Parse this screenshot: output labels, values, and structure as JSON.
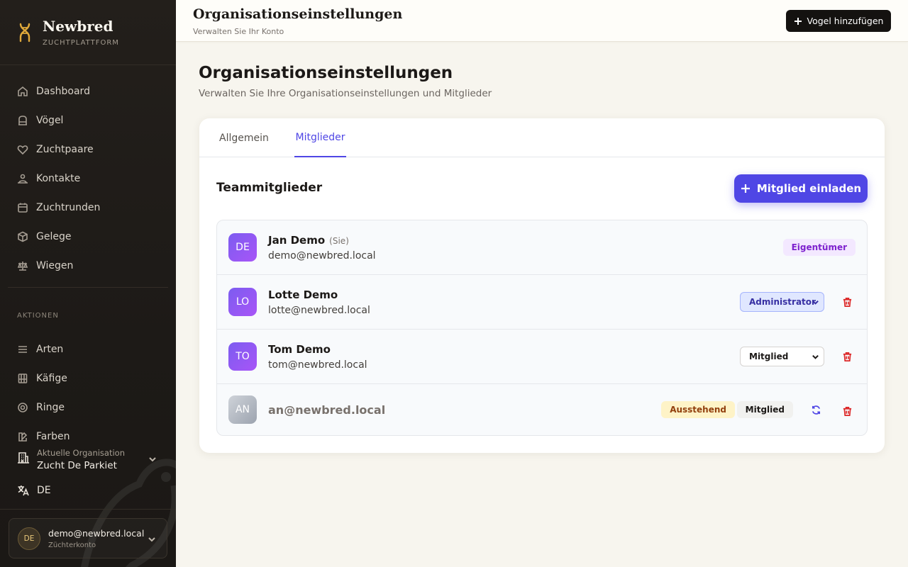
{
  "brand": {
    "name": "Newbred",
    "subtitle": "ZUCHTPLATTFORM"
  },
  "sidebar": {
    "items": [
      {
        "label": "Dashboard",
        "icon": "home-icon"
      },
      {
        "label": "Vögel",
        "icon": "cage-icon"
      },
      {
        "label": "Zuchtpaare",
        "icon": "heart-icon"
      },
      {
        "label": "Kontakte",
        "icon": "contacts-icon"
      },
      {
        "label": "Zuchtrunden",
        "icon": "calendar-icon"
      },
      {
        "label": "Gelege",
        "icon": "box-icon"
      },
      {
        "label": "Wiegen",
        "icon": "scale-icon"
      }
    ],
    "section_label": "AKTIONEN",
    "actions": [
      {
        "label": "Arten",
        "icon": "list-icon"
      },
      {
        "label": "Käfige",
        "icon": "cage-grid-icon"
      },
      {
        "label": "Ringe",
        "icon": "ring-icon"
      },
      {
        "label": "Farben",
        "icon": "palette-icon"
      }
    ],
    "organization": {
      "label": "Aktuelle Organisation",
      "name": "Zucht De Parkiet"
    },
    "language": "DE",
    "account": {
      "initials": "DE",
      "email": "demo@newbred.local",
      "type": "Züchterkonto"
    }
  },
  "topbar": {
    "title": "Organisationseinstellungen",
    "subtitle": "Verwalten Sie Ihr Konto",
    "add_bird_label": "Vogel hinzufügen"
  },
  "main": {
    "title": "Organisationseinstellungen",
    "subtitle": "Verwalten Sie Ihre Organisationseinstellungen und Mitglieder",
    "tabs": [
      {
        "label": "Allgemein"
      },
      {
        "label": "Mitglieder"
      }
    ],
    "active_tab": "Mitglieder",
    "section_title": "Teammitglieder",
    "invite_label": "Mitglied einladen",
    "members": [
      {
        "initials": "DE",
        "name": "Jan Demo",
        "you": "(Sie)",
        "email": "demo@newbred.local",
        "role": "Eigentümer"
      },
      {
        "initials": "LO",
        "name": "Lotte Demo",
        "email": "lotte@newbred.local",
        "role": "Administrator"
      },
      {
        "initials": "TO",
        "name": "Tom Demo",
        "email": "tom@newbred.local",
        "role": "Mitglied"
      }
    ],
    "pending": {
      "initials": "AN",
      "email": "an@newbred.local",
      "status": "Ausstehend",
      "role": "Mitglied"
    }
  },
  "colors": {
    "accent": "#4f46e5",
    "sidebar_bg": "#1d1a17",
    "owner_badge": "#f3e8ff",
    "pending_badge": "#fef3c7",
    "danger": "#dc2626"
  }
}
